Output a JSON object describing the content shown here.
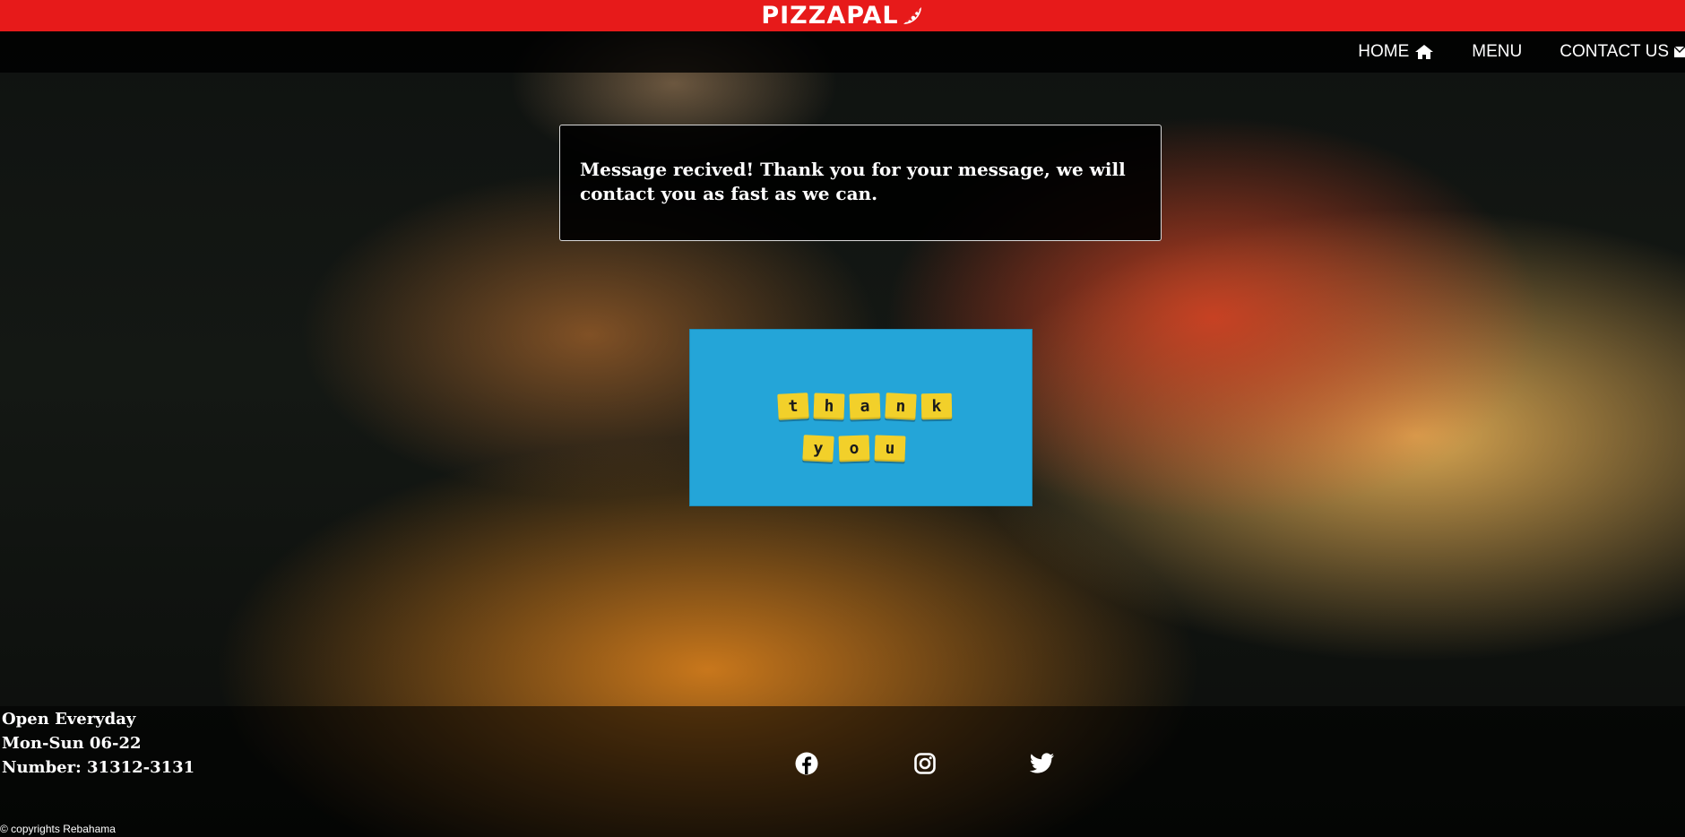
{
  "header": {
    "brand": "PIZZAPAL",
    "brand_icon": "pizza-slice-icon",
    "brand_color": "#e71a1a"
  },
  "nav": {
    "items": [
      {
        "label": "HOME",
        "icon": "home-icon"
      },
      {
        "label": "MENU"
      },
      {
        "label": "CONTACT US",
        "icon": "envelope-icon"
      }
    ]
  },
  "message": {
    "text": "Message recived! Thank you for your message, we will contact you as fast as we can."
  },
  "thank_you_image": {
    "row1": [
      "t",
      "h",
      "a",
      "n",
      "k"
    ],
    "row2": [
      "y",
      "o",
      "u"
    ],
    "background_color": "#24a5d8",
    "tile_color": "#f2d02a"
  },
  "footer": {
    "hours_line1": "Open Everyday",
    "hours_line2": "Mon-Sun 06-22",
    "phone_line": "Number: 31312-3131",
    "social_icons": [
      "facebook-icon",
      "instagram-icon",
      "twitter-icon"
    ],
    "copyright": "© copyrights Rebahama"
  }
}
